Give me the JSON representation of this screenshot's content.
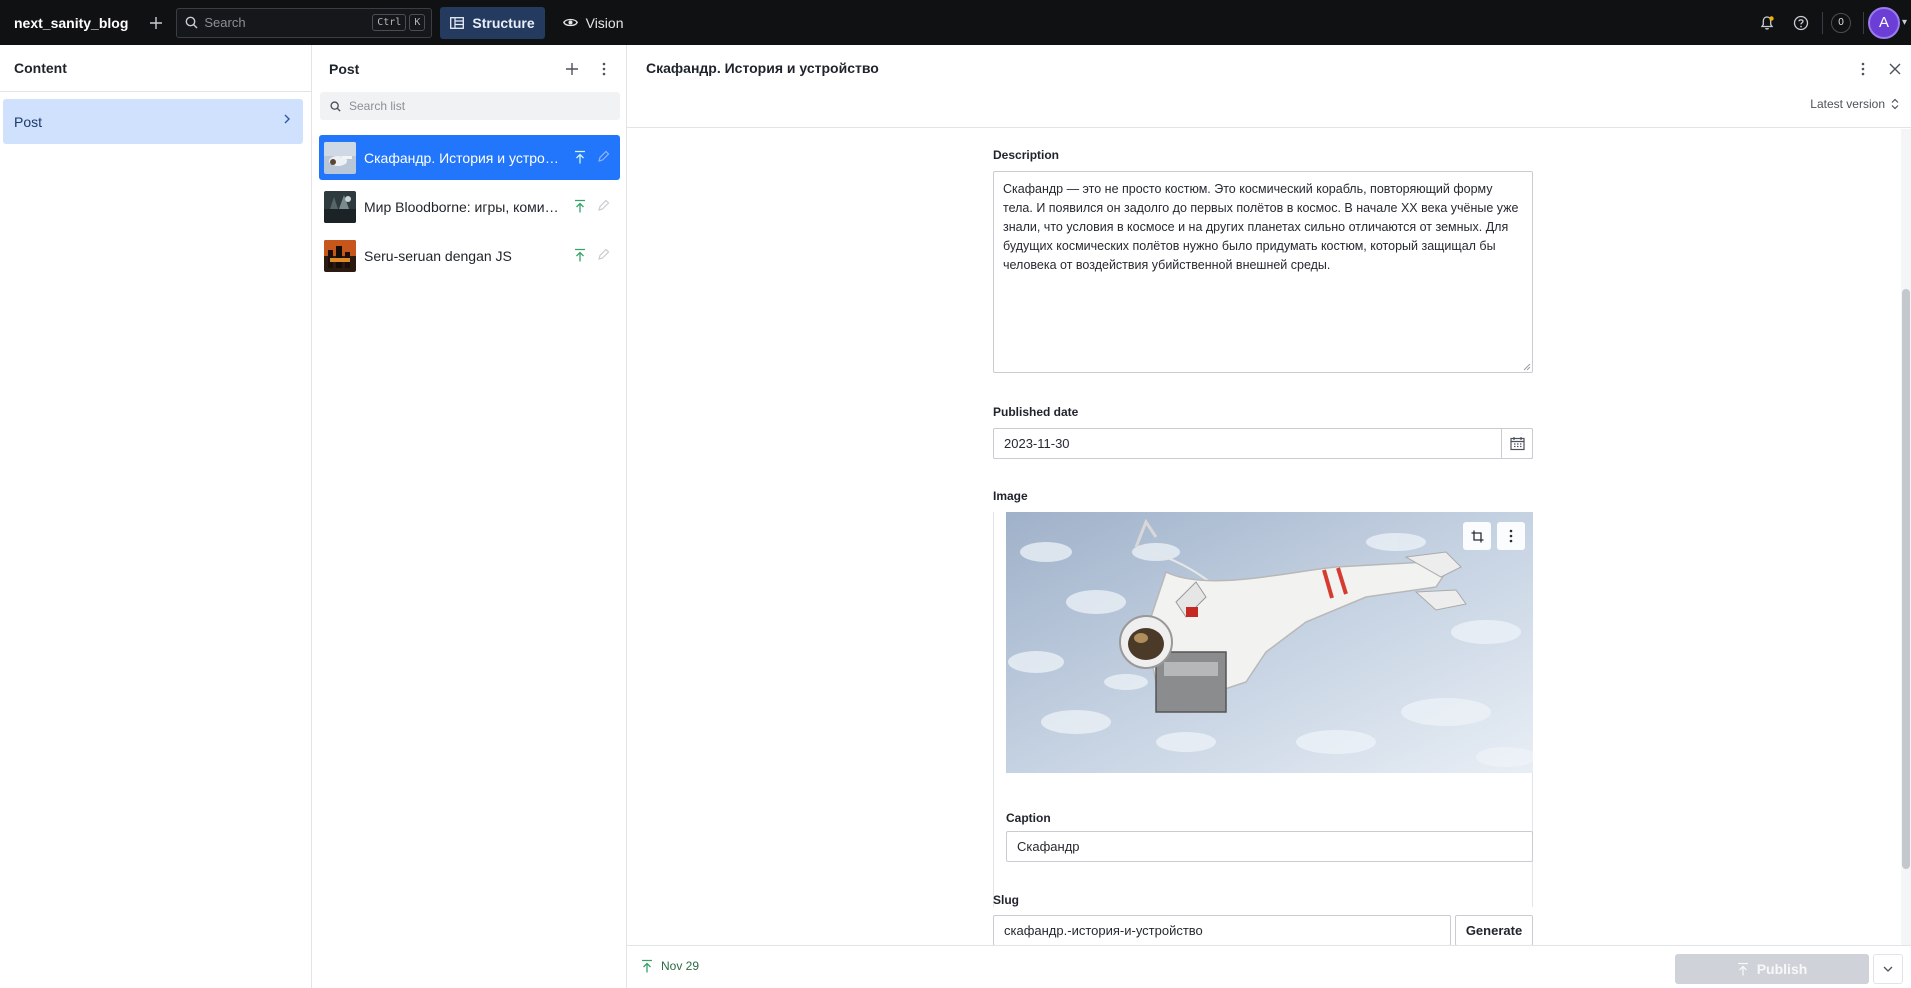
{
  "topbar": {
    "brand": "next_sanity_blog",
    "search_placeholder": "Search",
    "kbd_ctrl": "Ctrl",
    "kbd_k": "K",
    "tools": [
      {
        "label": "Structure",
        "active": true
      },
      {
        "label": "Vision",
        "active": false
      }
    ],
    "counter": "0",
    "avatar_initial": "A"
  },
  "content_pane": {
    "title": "Content",
    "items": [
      {
        "label": "Post",
        "selected": true
      }
    ]
  },
  "post_pane": {
    "title": "Post",
    "search_placeholder": "Search list",
    "items": [
      {
        "title": "Скафандр. История и устройство",
        "selected": true,
        "thumb": "astronaut"
      },
      {
        "title": "Мир Bloodborne: игры, комиксы и книги",
        "selected": false,
        "thumb": "bloodborne"
      },
      {
        "title": "Seru-seruan dengan JS",
        "selected": false,
        "thumb": "js"
      }
    ]
  },
  "document": {
    "title": "Скафандр. История и устройство",
    "version": "Latest version",
    "fields": {
      "description_label": "Description",
      "description_value": "Скафандр — это не просто костюм. Это космический корабль, повторяющий форму тела. И появился он задолго до первых полётов в космос. В начале XX века учёные уже знали, что условия в космосе и на других планетах сильно отличаются от земных. Для будущих космических полётов нужно было придумать костюм, который защищал бы человека от воздействия убийственной внешней среды.",
      "published_label": "Published date",
      "published_value": "2023-11-30",
      "image_label": "Image",
      "caption_label": "Caption",
      "caption_value": "Скафандр",
      "slug_label": "Slug",
      "slug_value": "скафандр.-история-и-устройство",
      "generate_label": "Generate"
    },
    "footer": {
      "status": "Nov 29",
      "publish_label": "Publish"
    }
  },
  "colors": {
    "accent": "#2276fc",
    "published_green": "#36a269",
    "topbar_bg": "#101112"
  }
}
